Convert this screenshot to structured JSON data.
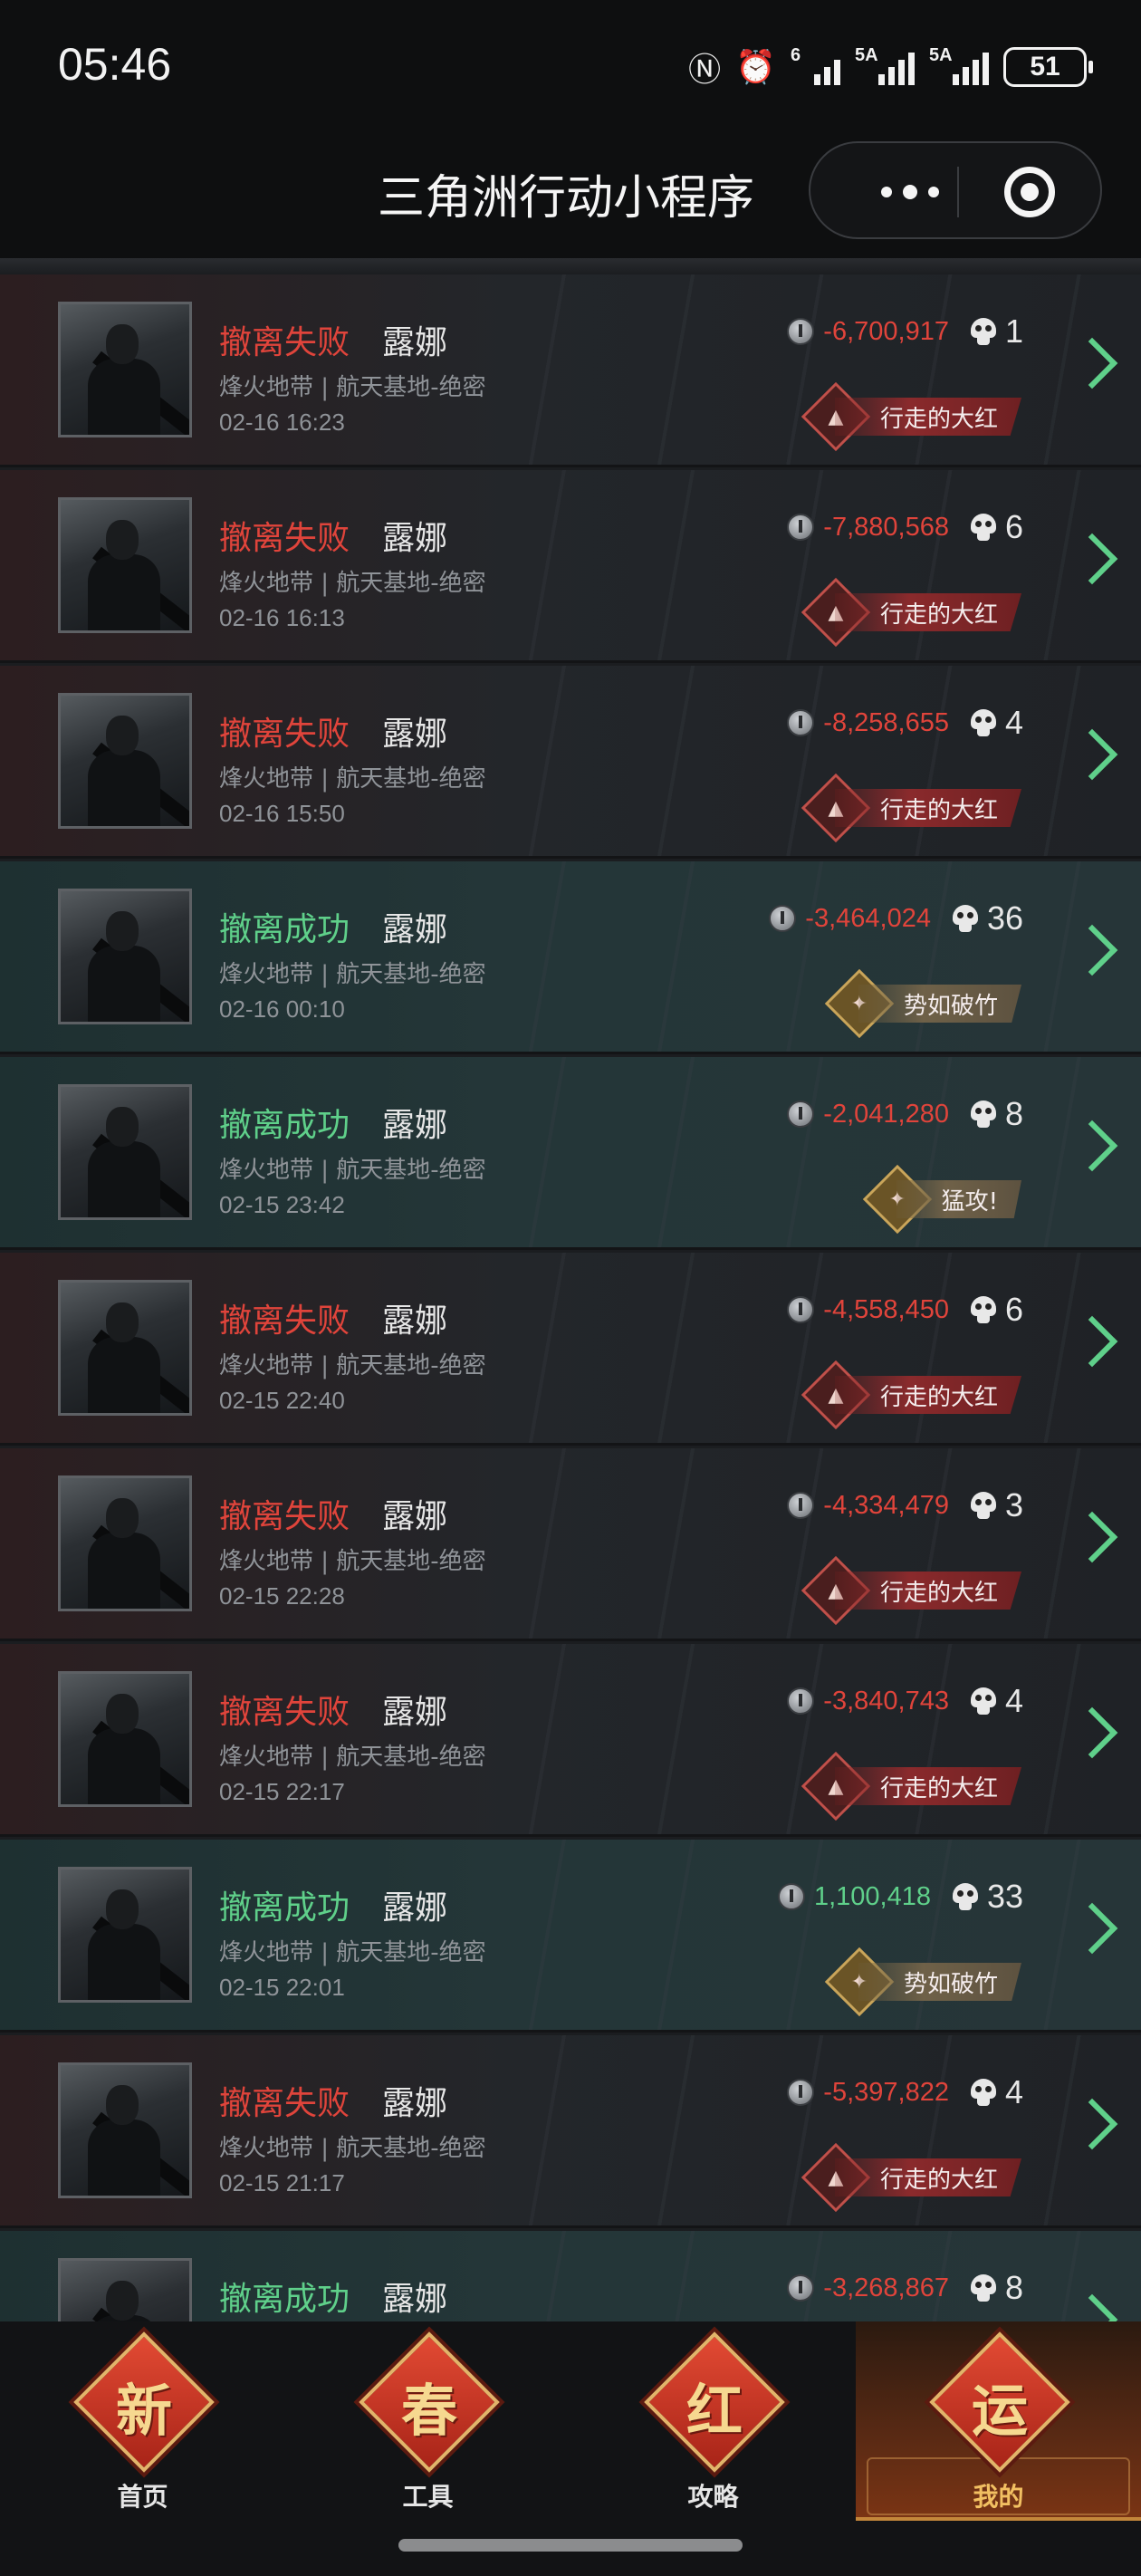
{
  "status_bar": {
    "time": "05:46",
    "nfc_icon": "Ⓝ",
    "alarm_icon": "⏰",
    "wifi_label": "6",
    "sig1_label": "5A",
    "sig2_label": "5A",
    "battery": "51"
  },
  "header": {
    "title": "三角洲行动小程序"
  },
  "records": [
    {
      "result": "撤离失败",
      "type": "fail",
      "operator": "露娜",
      "map": "烽火地带 | 航天基地-绝密",
      "time": "02-16 16:23",
      "value": "-6,700,917",
      "value_sign": "neg",
      "kills": "1",
      "badge": "行走的大红",
      "badge_style": "red",
      "badge_glyph": "▲"
    },
    {
      "result": "撤离失败",
      "type": "fail",
      "operator": "露娜",
      "map": "烽火地带 | 航天基地-绝密",
      "time": "02-16 16:13",
      "value": "-7,880,568",
      "value_sign": "neg",
      "kills": "6",
      "badge": "行走的大红",
      "badge_style": "red",
      "badge_glyph": "▲"
    },
    {
      "result": "撤离失败",
      "type": "fail",
      "operator": "露娜",
      "map": "烽火地带 | 航天基地-绝密",
      "time": "02-16 15:50",
      "value": "-8,258,655",
      "value_sign": "neg",
      "kills": "4",
      "badge": "行走的大红",
      "badge_style": "red",
      "badge_glyph": "▲"
    },
    {
      "result": "撤离成功",
      "type": "success",
      "operator": "露娜",
      "map": "烽火地带 | 航天基地-绝密",
      "time": "02-16 00:10",
      "value": "-3,464,024",
      "value_sign": "neg",
      "kills": "36",
      "badge": "势如破竹",
      "badge_style": "gold",
      "badge_glyph": "✦"
    },
    {
      "result": "撤离成功",
      "type": "success",
      "operator": "露娜",
      "map": "烽火地带 | 航天基地-绝密",
      "time": "02-15 23:42",
      "value": "-2,041,280",
      "value_sign": "neg",
      "kills": "8",
      "badge": "猛攻!",
      "badge_style": "gold",
      "badge_glyph": "✦"
    },
    {
      "result": "撤离失败",
      "type": "fail",
      "operator": "露娜",
      "map": "烽火地带 | 航天基地-绝密",
      "time": "02-15 22:40",
      "value": "-4,558,450",
      "value_sign": "neg",
      "kills": "6",
      "badge": "行走的大红",
      "badge_style": "red",
      "badge_glyph": "▲"
    },
    {
      "result": "撤离失败",
      "type": "fail",
      "operator": "露娜",
      "map": "烽火地带 | 航天基地-绝密",
      "time": "02-15 22:28",
      "value": "-4,334,479",
      "value_sign": "neg",
      "kills": "3",
      "badge": "行走的大红",
      "badge_style": "red",
      "badge_glyph": "▲"
    },
    {
      "result": "撤离失败",
      "type": "fail",
      "operator": "露娜",
      "map": "烽火地带 | 航天基地-绝密",
      "time": "02-15 22:17",
      "value": "-3,840,743",
      "value_sign": "neg",
      "kills": "4",
      "badge": "行走的大红",
      "badge_style": "red",
      "badge_glyph": "▲"
    },
    {
      "result": "撤离成功",
      "type": "success",
      "operator": "露娜",
      "map": "烽火地带 | 航天基地-绝密",
      "time": "02-15 22:01",
      "value": "1,100,418",
      "value_sign": "pos",
      "kills": "33",
      "badge": "势如破竹",
      "badge_style": "gold",
      "badge_glyph": "✦"
    },
    {
      "result": "撤离失败",
      "type": "fail",
      "operator": "露娜",
      "map": "烽火地带 | 航天基地-绝密",
      "time": "02-15 21:17",
      "value": "-5,397,822",
      "value_sign": "neg",
      "kills": "4",
      "badge": "行走的大红",
      "badge_style": "red",
      "badge_glyph": "▲"
    },
    {
      "result": "撤离成功",
      "type": "success",
      "operator": "露娜",
      "map": "",
      "time": "",
      "value": "-3,268,867",
      "value_sign": "neg",
      "kills": "8",
      "badge": "",
      "badge_style": "none",
      "badge_glyph": ""
    }
  ],
  "bottom_nav": [
    {
      "char": "新",
      "label": "首页",
      "active": false
    },
    {
      "char": "春",
      "label": "工具",
      "active": false
    },
    {
      "char": "红",
      "label": "攻略",
      "active": false
    },
    {
      "char": "运",
      "label": "我的",
      "active": true
    }
  ]
}
